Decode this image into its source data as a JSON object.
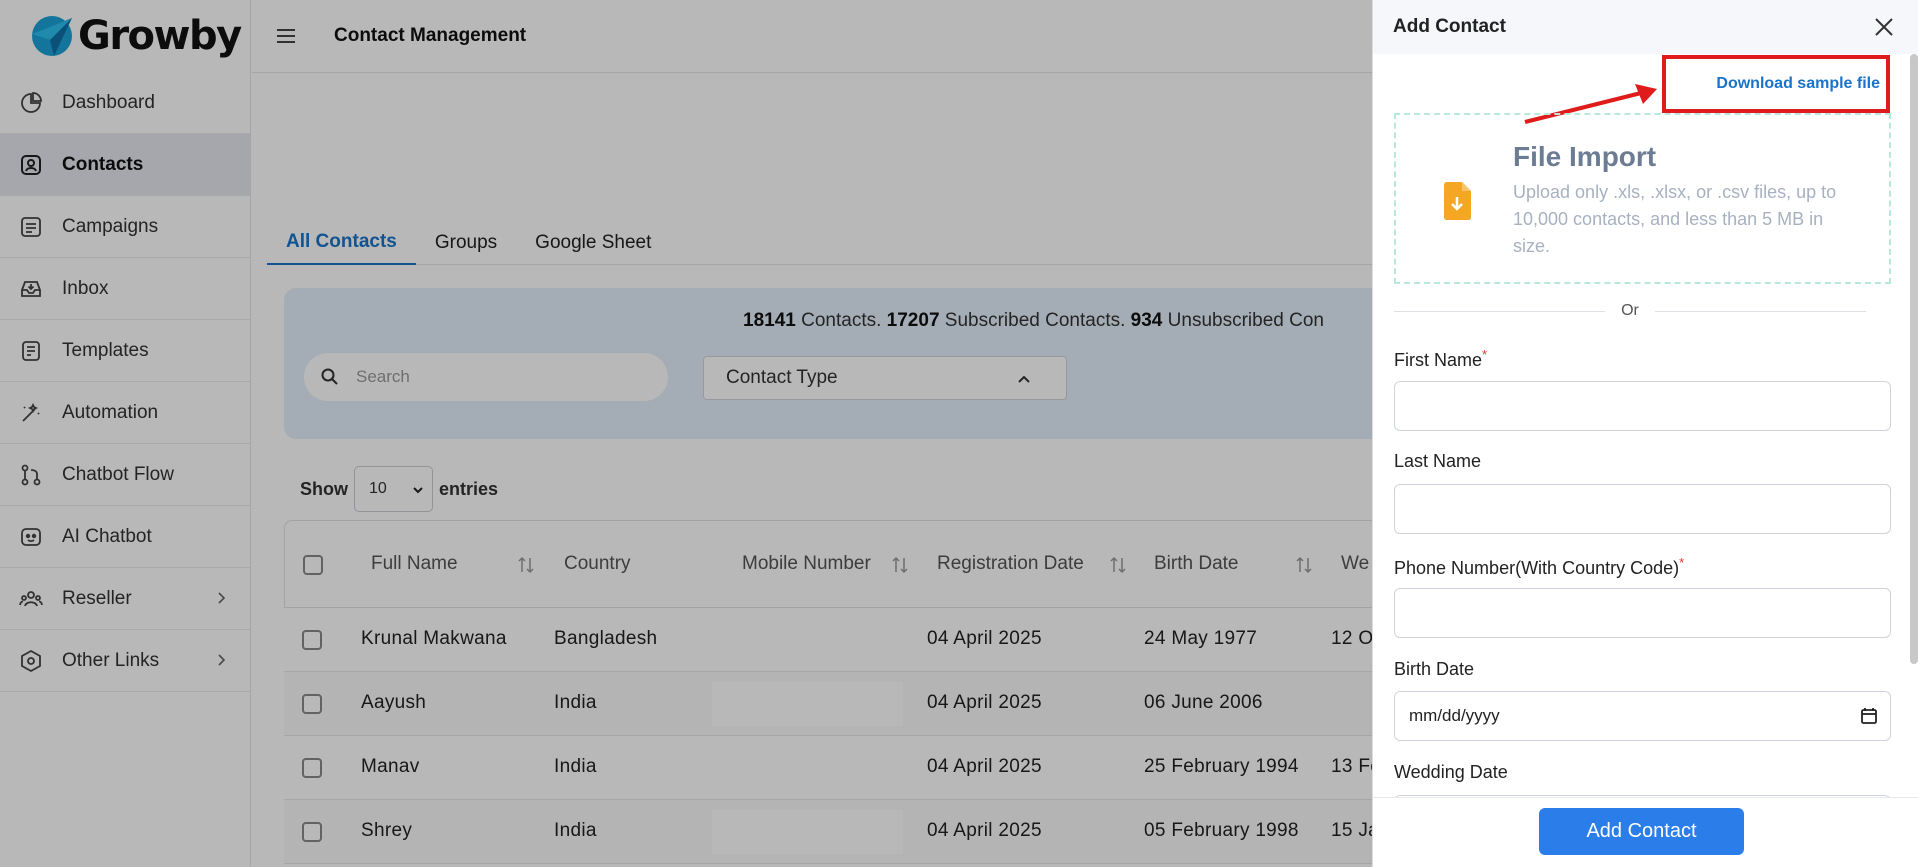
{
  "app": {
    "brand": "Growby"
  },
  "sidebar": {
    "items": [
      {
        "label": "Dashboard",
        "icon": "pie-chart-icon"
      },
      {
        "label": "Contacts",
        "icon": "contact-card-icon",
        "active": true
      },
      {
        "label": "Campaigns",
        "icon": "campaign-icon"
      },
      {
        "label": "Inbox",
        "icon": "inbox-icon"
      },
      {
        "label": "Templates",
        "icon": "template-icon"
      },
      {
        "label": "Automation",
        "icon": "magic-wand-icon"
      },
      {
        "label": "Chatbot Flow",
        "icon": "flow-icon"
      },
      {
        "label": "AI Chatbot",
        "icon": "bot-icon"
      },
      {
        "label": "Reseller",
        "icon": "users-icon",
        "has_submenu": true
      },
      {
        "label": "Other Links",
        "icon": "hexagon-icon",
        "has_submenu": true
      }
    ]
  },
  "header": {
    "title": "Contact Management"
  },
  "tabs": [
    "All Contacts",
    "Groups",
    "Google Sheet"
  ],
  "stats": {
    "contacts": "18141",
    "contacts_label": "Contacts.",
    "subscribed": "17207",
    "subscribed_label": "Subscribed Contacts.",
    "unsubscribed": "934",
    "unsubscribed_label": "Unsubscribed Con"
  },
  "filters": {
    "search_placeholder": "Search",
    "contact_type": "Contact Type"
  },
  "entries": {
    "show": "Show",
    "value": "10",
    "suffix": "entries"
  },
  "table": {
    "headers": [
      "Full Name",
      "Country",
      "Mobile Number",
      "Registration Date",
      "Birth Date",
      "We"
    ],
    "rows": [
      {
        "name": "Krunal Makwana",
        "country": "Bangladesh",
        "reg": "04 April 2025",
        "birth": "24 May 1977",
        "wedding": "12 O"
      },
      {
        "name": "Aayush",
        "country": "India",
        "reg": "04 April 2025",
        "birth": "06 June 2006",
        "wedding": ""
      },
      {
        "name": "Manav",
        "country": "India",
        "reg": "04 April 2025",
        "birth": "25 February 1994",
        "wedding": "13 Fe"
      },
      {
        "name": "Shrey",
        "country": "India",
        "reg": "04 April 2025",
        "birth": "05 February 1998",
        "wedding": "15 Ja"
      }
    ]
  },
  "drawer": {
    "title": "Add Contact",
    "download_link": "Download sample file",
    "file_import_title": "File Import",
    "file_import_desc": "Upload only .xls, .xlsx, or .csv files, up to 10,000 contacts, and less than 5 MB in size.",
    "or": "Or",
    "first_name": "First Name",
    "last_name": "Last Name",
    "phone": "Phone Number(With Country Code)",
    "birth_date": "Birth Date",
    "date_placeholder": "mm/dd/yyyy",
    "wedding_date": "Wedding Date",
    "submit": "Add Contact"
  },
  "colors": {
    "accent": "#1a73c9",
    "button": "#2b7de9",
    "highlight": "#e01b1b",
    "file_icon": "#f5a623"
  }
}
